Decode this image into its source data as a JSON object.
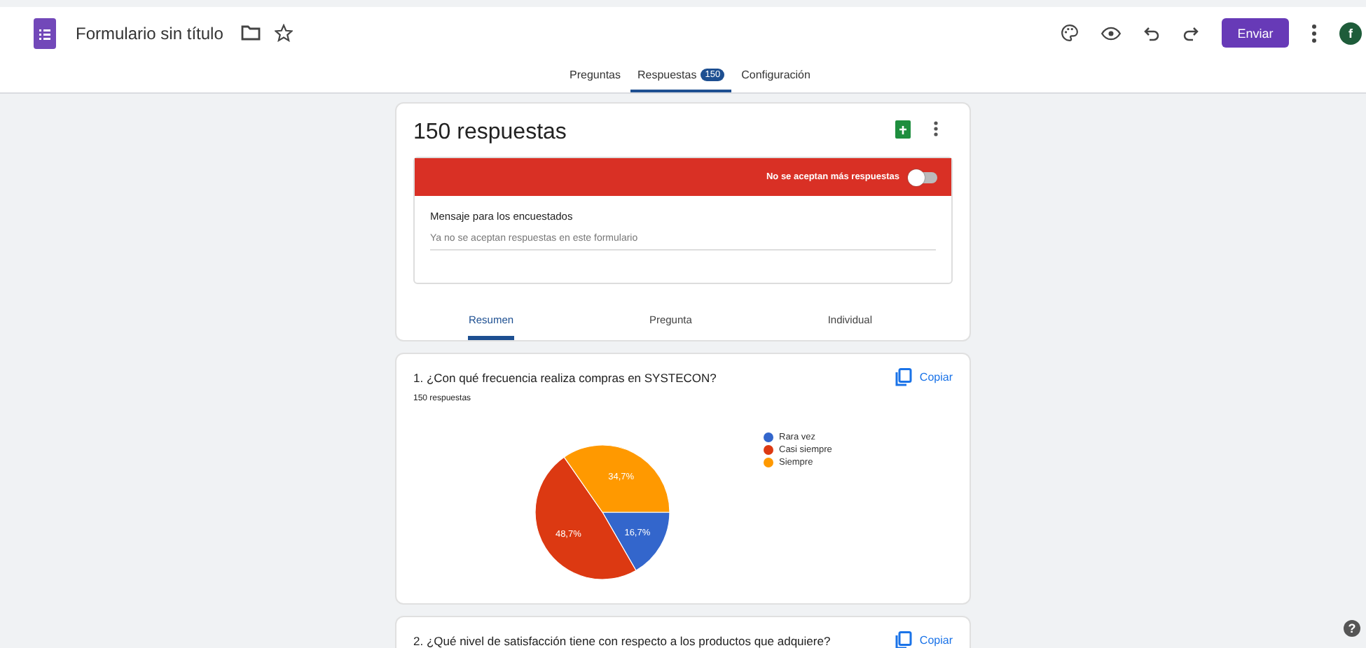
{
  "header": {
    "title": "Formulario sin título",
    "send_button": "Enviar",
    "avatar": "f"
  },
  "tabs": [
    {
      "label": "Preguntas",
      "selected": false
    },
    {
      "label": "Respuestas",
      "selected": true,
      "badge": "150"
    },
    {
      "label": "Configuración",
      "selected": false
    }
  ],
  "summary": {
    "title": "150 respuestas",
    "banner": {
      "label": "No se aceptan más respuestas",
      "on": false
    },
    "message_label": "Mensaje para los encuestados",
    "message_value": "Ya no se aceptan respuestas en este formulario",
    "view_tabs": [
      {
        "label": "Resumen",
        "selected": true
      },
      {
        "label": "Pregunta",
        "selected": false
      },
      {
        "label": "Individual",
        "selected": false
      }
    ]
  },
  "questions": [
    {
      "title": "1. ¿Con qué frecuencia realiza compras en SYSTECON?",
      "copy": "Copiar",
      "count": "150 respuestas",
      "chart_data": {
        "type": "pie",
        "categories": [
          "Rara vez",
          "Casi siempre",
          "Siempre"
        ],
        "values": [
          16.7,
          48.7,
          34.7
        ],
        "legend": "right",
        "colors": [
          "#3366cc",
          "#dc3912",
          "#ff9900"
        ],
        "value_labels": [
          "16,7%",
          "48,7%",
          "34,7%"
        ]
      }
    },
    {
      "title": "2. ¿Qué nivel de satisfacción tiene con respecto a los productos que adquiere?",
      "copy": "Copiar"
    }
  ],
  "help": "?"
}
